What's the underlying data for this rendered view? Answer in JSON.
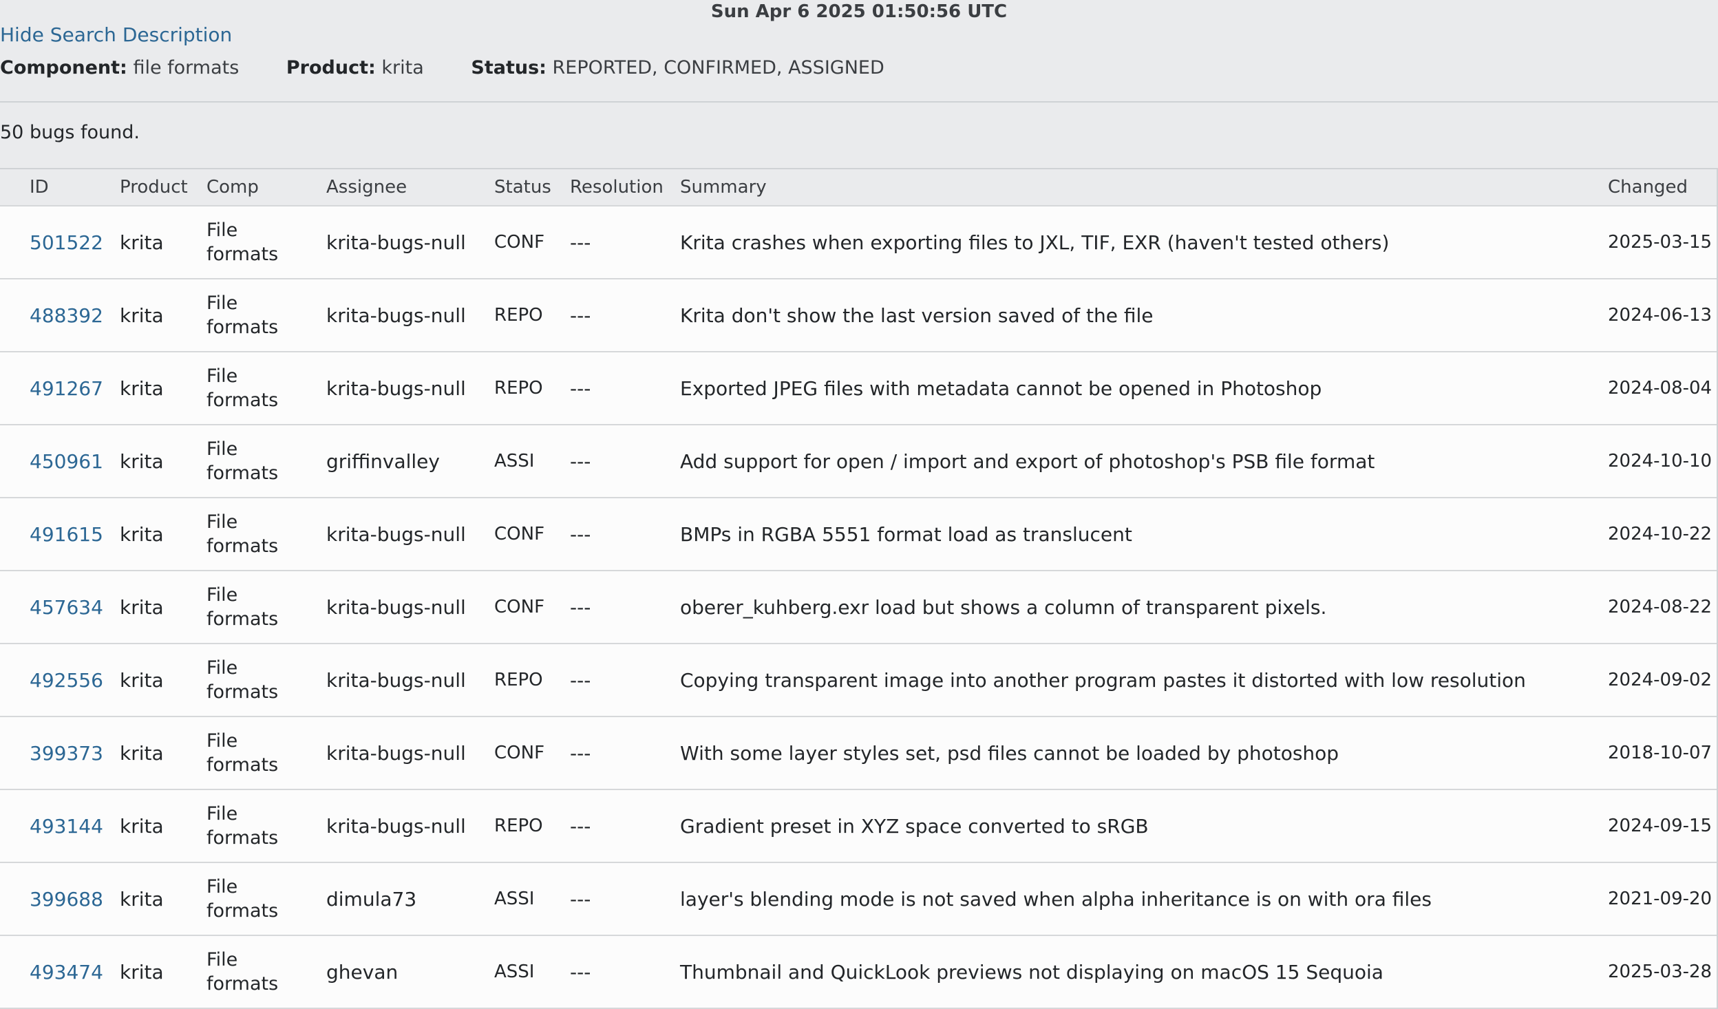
{
  "timestamp": "Sun Apr 6 2025 01:50:56 UTC",
  "search": {
    "toggle_label": "Hide Search Description",
    "component_label": "Component:",
    "component_value": "file formats",
    "product_label": "Product:",
    "product_value": "krita",
    "status_label": "Status:",
    "status_value": "REPORTED, CONFIRMED, ASSIGNED"
  },
  "bug_count_text": "50 bugs found.",
  "table": {
    "headers": [
      "ID",
      "Product",
      "Comp",
      "Assignee",
      "Status",
      "Resolution",
      "Summary",
      "Changed"
    ],
    "rows": [
      {
        "id": "501522",
        "product": "krita",
        "comp": "File formats",
        "assignee": "krita-bugs-null",
        "status": "CONF",
        "resolution": "---",
        "summary": "Krita crashes when exporting files to JXL, TIF, EXR (haven't tested others)",
        "changed": "2025-03-15"
      },
      {
        "id": "488392",
        "product": "krita",
        "comp": "File formats",
        "assignee": "krita-bugs-null",
        "status": "REPO",
        "resolution": "---",
        "summary": "Krita don't show the last version saved of the file",
        "changed": "2024-06-13"
      },
      {
        "id": "491267",
        "product": "krita",
        "comp": "File formats",
        "assignee": "krita-bugs-null",
        "status": "REPO",
        "resolution": "---",
        "summary": "Exported JPEG files with metadata cannot be opened in Photoshop",
        "changed": "2024-08-04"
      },
      {
        "id": "450961",
        "product": "krita",
        "comp": "File formats",
        "assignee": "griffinvalley",
        "status": "ASSI",
        "resolution": "---",
        "summary": "Add support for open / import and export of photoshop's PSB file format",
        "changed": "2024-10-10"
      },
      {
        "id": "491615",
        "product": "krita",
        "comp": "File formats",
        "assignee": "krita-bugs-null",
        "status": "CONF",
        "resolution": "---",
        "summary": "BMPs in RGBA 5551 format load as translucent",
        "changed": "2024-10-22"
      },
      {
        "id": "457634",
        "product": "krita",
        "comp": "File formats",
        "assignee": "krita-bugs-null",
        "status": "CONF",
        "resolution": "---",
        "summary": "oberer_kuhberg.exr load but shows a column of transparent pixels.",
        "changed": "2024-08-22"
      },
      {
        "id": "492556",
        "product": "krita",
        "comp": "File formats",
        "assignee": "krita-bugs-null",
        "status": "REPO",
        "resolution": "---",
        "summary": "Copying transparent image into another program pastes it distorted with low resolution",
        "changed": "2024-09-02"
      },
      {
        "id": "399373",
        "product": "krita",
        "comp": "File formats",
        "assignee": "krita-bugs-null",
        "status": "CONF",
        "resolution": "---",
        "summary": "With some layer styles set, psd files cannot be loaded by photoshop",
        "changed": "2018-10-07"
      },
      {
        "id": "493144",
        "product": "krita",
        "comp": "File formats",
        "assignee": "krita-bugs-null",
        "status": "REPO",
        "resolution": "---",
        "summary": "Gradient preset in XYZ space converted to sRGB",
        "changed": "2024-09-15"
      },
      {
        "id": "399688",
        "product": "krita",
        "comp": "File formats",
        "assignee": "dimula73",
        "status": "ASSI",
        "resolution": "---",
        "summary": "layer's blending mode is not saved when alpha inheritance is on with ora files",
        "changed": "2021-09-20"
      },
      {
        "id": "493474",
        "product": "krita",
        "comp": "File formats",
        "assignee": "ghevan",
        "status": "ASSI",
        "resolution": "---",
        "summary": "Thumbnail and QuickLook previews not displaying on macOS 15 Sequoia",
        "changed": "2025-03-28"
      }
    ]
  },
  "colors": {
    "link": "#2c6794",
    "page_background": "#eaebed",
    "row_background": "#fcfcfc"
  }
}
